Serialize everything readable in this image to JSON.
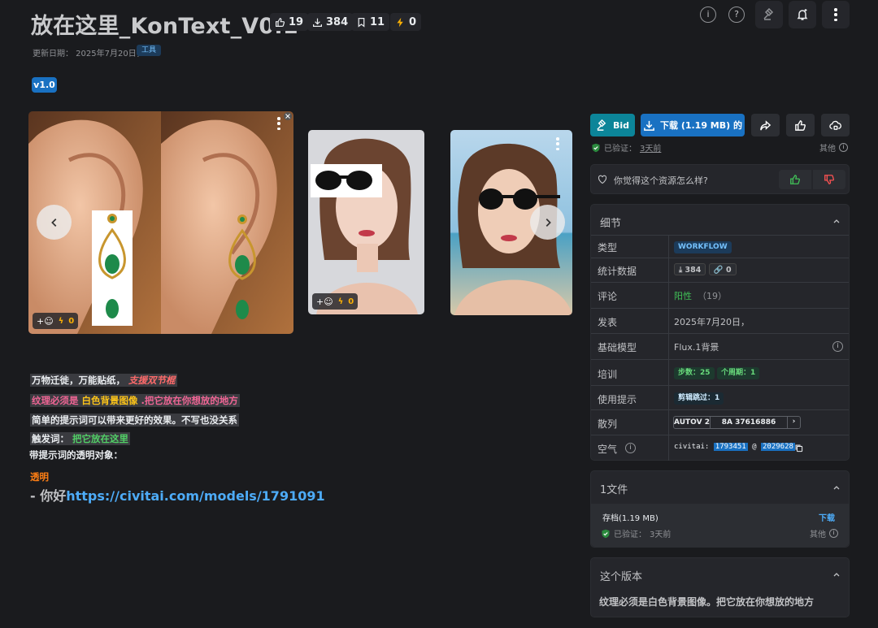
{
  "header": {
    "title": "放在这里_KonText_V0.1",
    "stats": {
      "likes": "19",
      "downloads": "384",
      "bookmarks": "11",
      "buzz": "0"
    },
    "updated": "更新日期： 2025年7月20日，",
    "tag": "工具",
    "version": "v1.0"
  },
  "gallery": {
    "reaction_add": "+☺",
    "card1_buzz": "0",
    "card2_buzz": "0"
  },
  "description": {
    "line1_a": "万物迁徙，万能贴纸，",
    "line1_b": "支援双节棍",
    "line2_a": "纹理必须是",
    "line2_b": "白色背景图像",
    "line2_c": ".把它放在你想放的地方",
    "line3": "简单的提示词可以带来更好的效果。不写也没关系",
    "line4_a": "触发词：",
    "line4_b": "把它放在这里",
    "line5": "带提示词的透明对象：",
    "line6": "透明",
    "line7_a": "- 你好",
    "line7_b": "https://civitai.com/models/1791091"
  },
  "actions": {
    "bid_label": "Bid",
    "download_label": "下载 (1.19 MB) 的",
    "verified": "已验证：",
    "verified_time": "3天前",
    "other": "其他"
  },
  "feedback": {
    "question": "你觉得这个资源怎么样?"
  },
  "details": {
    "title": "细节",
    "rows": [
      {
        "key": "类型",
        "value": "WORKFLOW"
      },
      {
        "key": "统计数据",
        "downloads": "384",
        "links": "0"
      },
      {
        "key": "评论",
        "value": "阳性",
        "count": "（19）"
      },
      {
        "key": "发表",
        "value": "2025年7月20日，"
      },
      {
        "key": "基础模型",
        "value": "Flux.1背景"
      },
      {
        "key": "培训",
        "steps": "步数：25",
        "epochs": "个周期：1"
      },
      {
        "key": "使用提示",
        "value": "剪辑跳过：1"
      },
      {
        "key": "散列",
        "algo": "AUTOV 2",
        "hash": "8A 37616886"
      },
      {
        "key": "空气",
        "prefix": "civitai:",
        "id1": "1793451",
        "at": "@",
        "id2": "2029628"
      }
    ]
  },
  "files": {
    "title": "1文件",
    "name": "存档(1.19 MB)",
    "download": "下载",
    "verified": "已验证：",
    "verified_time": "3天前",
    "other": "其他"
  },
  "version_panel": {
    "title": "这个版本",
    "text": "纹理必须是白色背景图像。把它放在你想放的地方"
  },
  "colors": {
    "background": "#1a1b1e",
    "panel": "#25262b",
    "accent_blue": "#1971c2",
    "bid_teal": "#0c8599",
    "positive_green": "#40c057"
  }
}
